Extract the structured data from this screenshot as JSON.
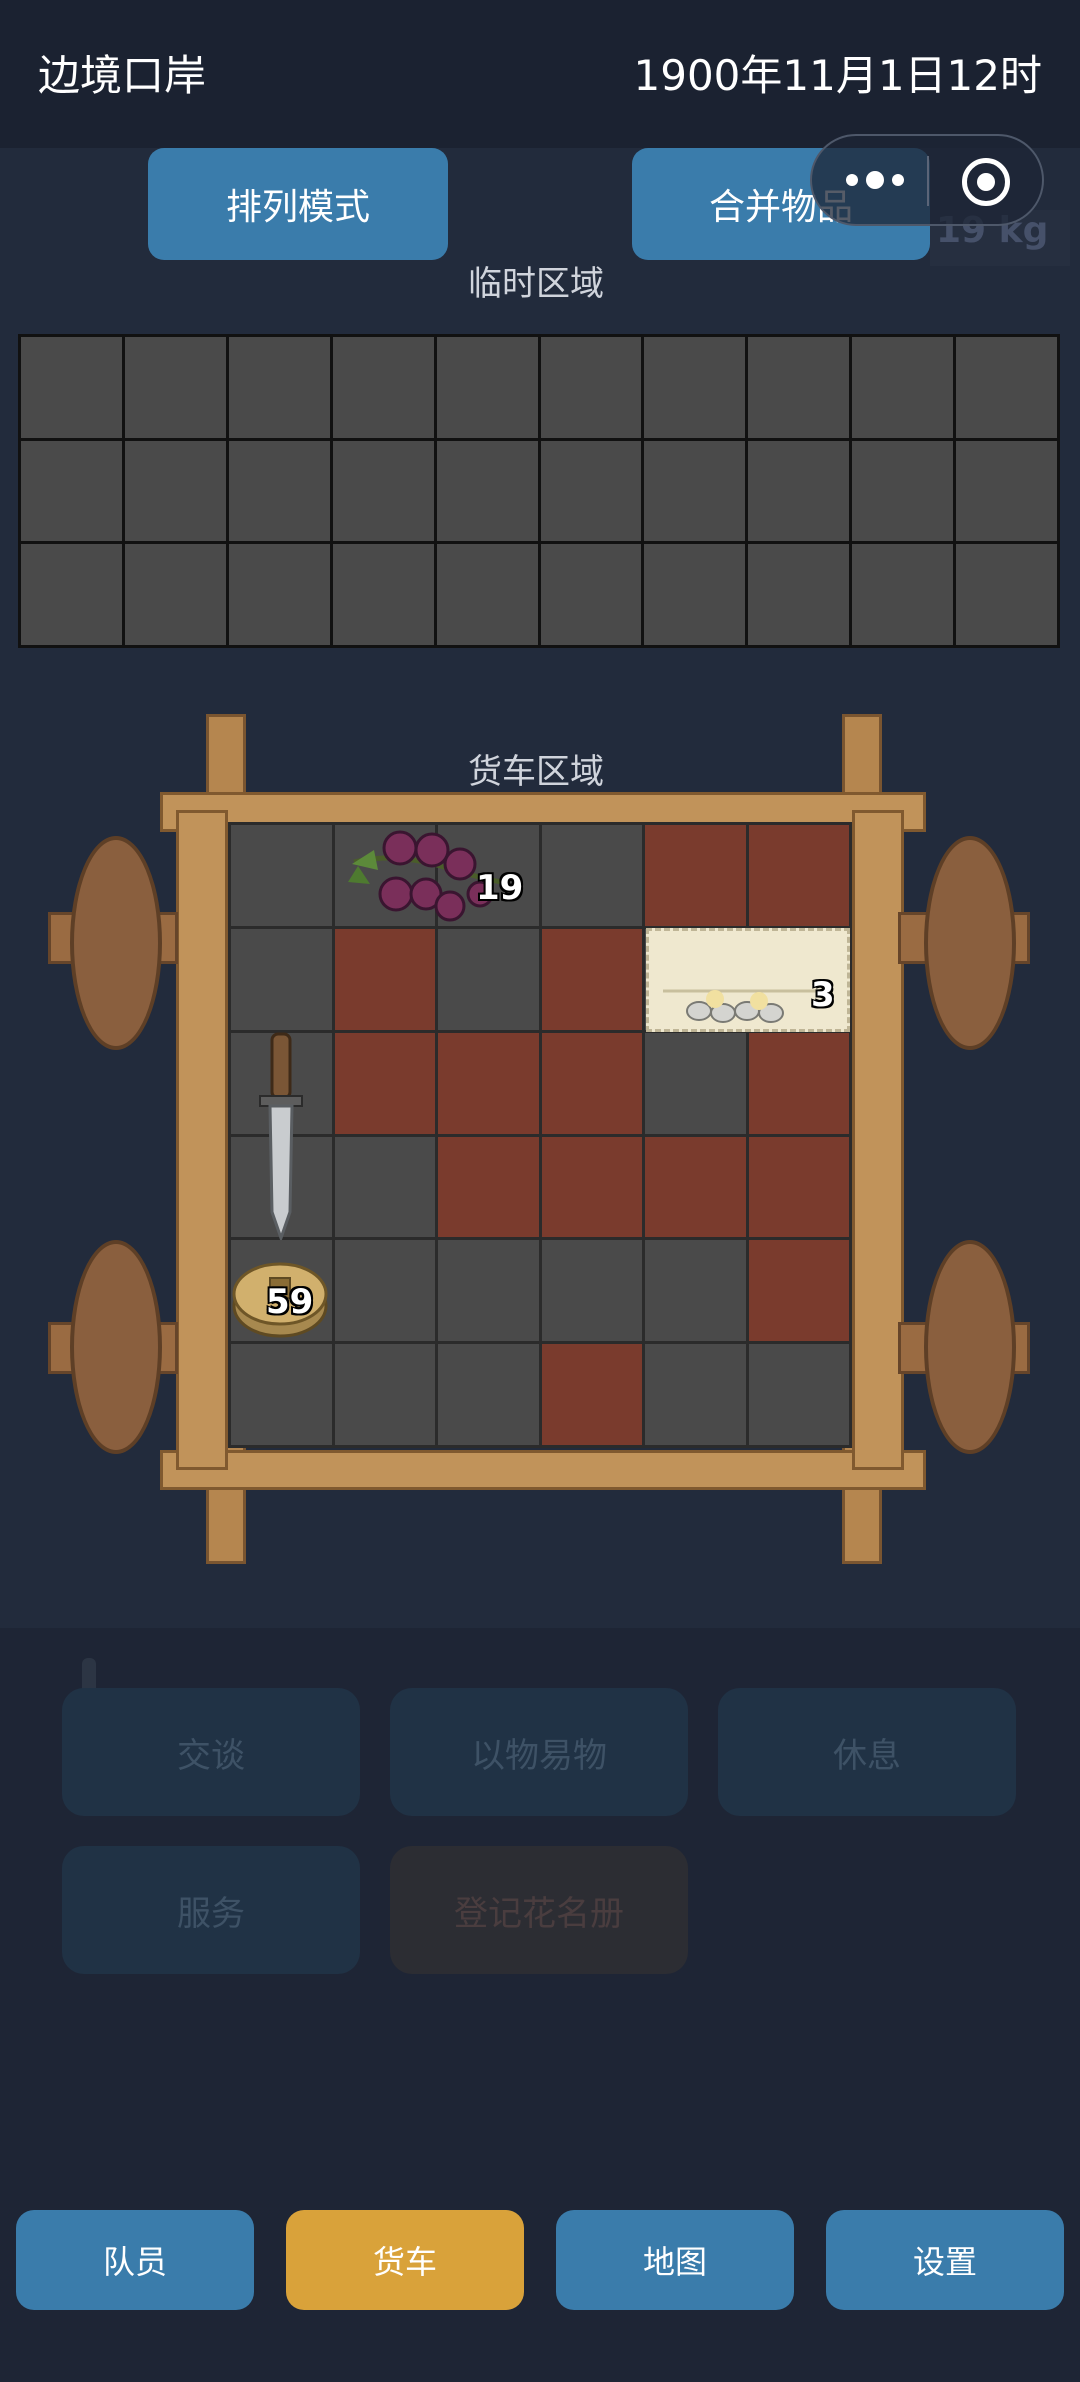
{
  "topbar": {
    "location": "边境口岸",
    "datetime": "1900年11月1日12时"
  },
  "toolbar": {
    "sort_label": "排列模式",
    "merge_label": "合并物品",
    "weight": "19 kg"
  },
  "temp_area": {
    "label": "临时区域"
  },
  "truck_area": {
    "label": "货车区域"
  },
  "items": {
    "berries": {
      "count": "19",
      "icon": "blackberry-icon"
    },
    "bandage": {
      "count": "3",
      "icon": "bandage-pack-icon"
    },
    "knife": {
      "icon": "knife-icon"
    },
    "coins": {
      "count": "59",
      "icon": "coin-stack-icon"
    }
  },
  "actions": {
    "talk": "交谈",
    "barter": "以物易物",
    "rest": "休息",
    "service": "服务",
    "register": "登记花名册"
  },
  "nav": {
    "crew": "队员",
    "truck": "货车",
    "map": "地图",
    "settings": "设置"
  },
  "colors": {
    "accent_blue": "#3a7cab",
    "accent_gold": "#d9a23a",
    "blocked_cell": "#7a3b2d",
    "empty_cell": "#4a4a4a"
  }
}
